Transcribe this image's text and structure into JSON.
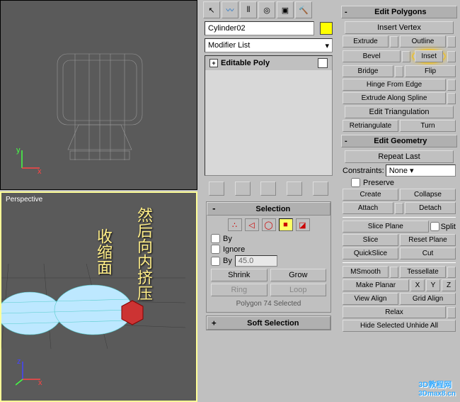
{
  "viewports": {
    "top_label": "",
    "bottom_label": "Perspective"
  },
  "toolbar_icons": [
    "select",
    "curve",
    "hierarchy",
    "wheel",
    "display",
    "utilities"
  ],
  "object_name": "Cylinder02",
  "modifier_dropdown": "Modifier List",
  "mod_stack_item": "Editable Poly",
  "selection": {
    "header": "Selection",
    "by_vertex": "By",
    "ignore": "Ignore",
    "by_angle": "By",
    "angle_value": "45.0",
    "shrink": "Shrink",
    "grow": "Grow",
    "ring": "Ring",
    "loop": "Loop",
    "status": "Polygon 74 Selected"
  },
  "soft_selection_header": "Soft Selection",
  "edit_polygons": {
    "header": "Edit Polygons",
    "insert_vertex": "Insert Vertex",
    "extrude": "Extrude",
    "outline": "Outline",
    "bevel": "Bevel",
    "inset": "Inset",
    "bridge": "Bridge",
    "flip": "Flip",
    "hinge": "Hinge From Edge",
    "extrude_spline": "Extrude Along Spline",
    "edit_tri": "Edit Triangulation",
    "retri": "Retriangulate",
    "turn": "Turn"
  },
  "edit_geometry": {
    "header": "Edit Geometry",
    "repeat": "Repeat Last",
    "constraints_label": "Constraints:",
    "constraints_value": "None",
    "preserve": "Preserve",
    "create": "Create",
    "collapse": "Collapse",
    "attach": "Attach",
    "detach": "Detach",
    "slice_plane": "Slice Plane",
    "split": "Split",
    "slice": "Slice",
    "reset_plane": "Reset Plane",
    "quickslice": "QuickSlice",
    "cut": "Cut",
    "msmooth": "MSmooth",
    "tessellate": "Tessellate",
    "make_planar": "Make Planar",
    "x": "X",
    "y": "Y",
    "z": "Z",
    "view_align": "View Align",
    "grid_align": "Grid Align",
    "relax": "Relax",
    "hide_sel": "Hide Selected Unhide All"
  },
  "annotations": [
    "收缩面",
    "然后向内挤压"
  ],
  "watermark": {
    "line1": "3D教程网",
    "line2": "3Dmax8.cn"
  }
}
